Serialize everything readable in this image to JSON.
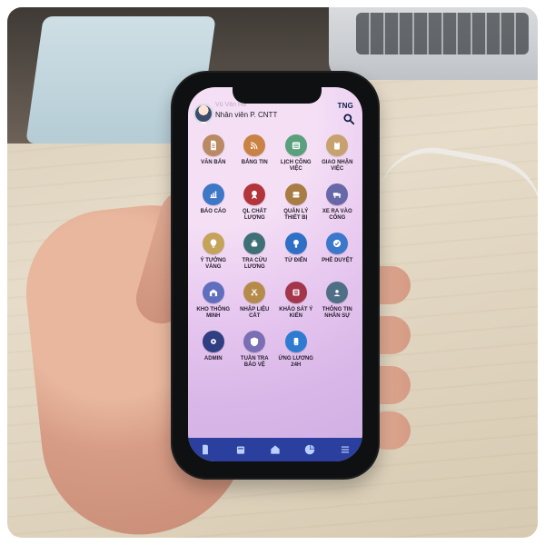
{
  "profile": {
    "name_blurred": "Vũ Văn Hà",
    "role": "Nhân viên P. CNTT",
    "brand": "TNG"
  },
  "apps": [
    {
      "label": "VĂN BẢN",
      "icon": "document-icon",
      "color": "#b98a63"
    },
    {
      "label": "BẢNG TIN",
      "icon": "rss-icon",
      "color": "#c98243"
    },
    {
      "label": "LỊCH CÔNG\nVIỆC",
      "icon": "calendar-grid-icon",
      "color": "#5aa07c"
    },
    {
      "label": "GIAO NHẬN\nVIỆC",
      "icon": "clipboard-icon",
      "color": "#c7a26f"
    },
    {
      "label": "BÁO CÁO",
      "icon": "bar-chart-icon",
      "color": "#3f77c7"
    },
    {
      "label": "QL CHẤT\nLƯỢNG",
      "icon": "award-icon",
      "color": "#b3353b"
    },
    {
      "label": "QUẢN LÝ\nTHIẾT BỊ",
      "icon": "sewing-machine-icon",
      "color": "#a77d45"
    },
    {
      "label": "XE RA VÀO\nCỔNG",
      "icon": "truck-icon",
      "color": "#6867a8"
    },
    {
      "label": "Ý TƯỞNG\nVÀNG",
      "icon": "lightbulb-icon",
      "color": "#c4a35b"
    },
    {
      "label": "TRA CỨU\nLƯƠNG",
      "icon": "money-bag-icon",
      "color": "#3f6f77"
    },
    {
      "label": "TỪ ĐIỂN",
      "icon": "dictionary-icon",
      "color": "#2f6fc5"
    },
    {
      "label": "PHÊ DUYỆT",
      "icon": "approve-icon",
      "color": "#3b78c9"
    },
    {
      "label": "KHO THÔNG\nMINH",
      "icon": "warehouse-icon",
      "color": "#5f6fbe"
    },
    {
      "label": "NHẬP LIỆU\nCẮT",
      "icon": "scissors-icon",
      "color": "#b58b4b"
    },
    {
      "label": "KHẢO SÁT Ý\nKIẾN",
      "icon": "survey-icon",
      "color": "#a3364a"
    },
    {
      "label": "THÔNG TIN\nNHÂN SỰ",
      "icon": "user-info-icon",
      "color": "#4f6f86"
    },
    {
      "label": "ADMIN",
      "icon": "admin-gear-icon",
      "color": "#2f3f82"
    },
    {
      "label": "TUẦN TRA\nBẢO VỆ",
      "icon": "shield-icon",
      "color": "#7a6fb4"
    },
    {
      "label": "ỨNG LƯƠNG\n24H",
      "icon": "mobile-pay-icon",
      "color": "#2f7bd0"
    }
  ],
  "bottom_nav": [
    {
      "icon": "documents-nav-icon"
    },
    {
      "icon": "calendar-nav-icon"
    },
    {
      "icon": "home-nav-icon"
    },
    {
      "icon": "pie-chart-nav-icon"
    },
    {
      "icon": "menu-nav-icon"
    }
  ]
}
